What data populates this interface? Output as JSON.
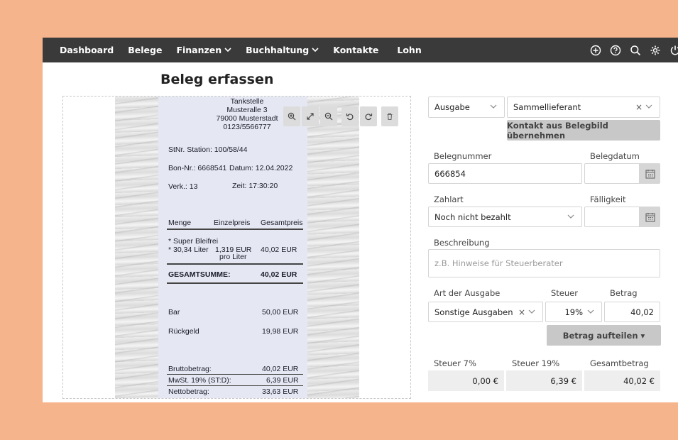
{
  "nav": {
    "items": [
      {
        "label": "Dashboard",
        "dropdown": false
      },
      {
        "label": "Belege",
        "dropdown": false
      },
      {
        "label": "Finanzen",
        "dropdown": true
      },
      {
        "label": "Buchhaltung",
        "dropdown": true
      },
      {
        "label": "Kontakte",
        "dropdown": false
      },
      {
        "label": "Lohn",
        "dropdown": false
      }
    ],
    "icons": [
      "add-circle-icon",
      "help-icon",
      "search-icon",
      "gear-icon",
      "power-icon"
    ]
  },
  "page": {
    "title": "Beleg erfassen"
  },
  "receipt": {
    "station_name": "Tankstelle",
    "street": "Musteralle 3",
    "city": "79000 Musterstadt",
    "phone": "0123/5566777",
    "stnr": "StNr. Station: 100/58/44",
    "bon_nr": "Bon-Nr.: 6668541",
    "datum": "Datum: 12.04.2022",
    "verk": "Verk.: 13",
    "zeit": "Zeit: 17:30:20",
    "col_menge": "Menge",
    "col_einzelpreis": "Einzelpreis",
    "col_gesamtpreis": "Gesamtpreis",
    "item_name": "* Super Bleifrei",
    "item_qty": "* 30,34 Liter",
    "item_unit_price": "1,319 EUR",
    "item_unit": "pro Liter",
    "item_total": "40,02 EUR",
    "gesamt_label": "GESAMTSUMME:",
    "gesamt_value": "40,02 EUR",
    "bar_label": "Bar",
    "bar_value": "50,00 EUR",
    "rueck_label": "Rückgeld",
    "rueck_value": "19,98 EUR",
    "brutto_label": "Bruttobetrag:",
    "brutto_value": "40,02 EUR",
    "mwst_label": "MwSt. 19% (ST:D):",
    "mwst_value": "6,39 EUR",
    "netto_label": "Nettobetrag:",
    "netto_value": "33,63 EUR"
  },
  "image_toolbar": [
    "zoom-in-icon",
    "expand-icon",
    "zoom-out-icon",
    "rotate-left-icon",
    "rotate-right-icon",
    "trash-icon"
  ],
  "form": {
    "type_select": "Ausgabe",
    "contact_select": "Sammellieferant",
    "contact_button": "Kontakt aus Belegbild übernehmen",
    "belegnummer_label": "Belegnummer",
    "belegnummer_value": "666854",
    "belegdatum_label": "Belegdatum",
    "belegdatum_value": "",
    "zahlart_label": "Zahlart",
    "zahlart_value": "Noch nicht bezahlt",
    "faelligkeit_label": "Fälligkeit",
    "faelligkeit_value": "",
    "beschreibung_label": "Beschreibung",
    "beschreibung_placeholder": "z.B. Hinweise für Steuerberater",
    "art_label": "Art der Ausgabe",
    "art_value": "Sonstige Ausgaben",
    "steuer_label": "Steuer",
    "steuer_value": "19%",
    "betrag_label": "Betrag",
    "betrag_value": "40,02",
    "split_button": "Betrag aufteilen ▾",
    "steuer7_label": "Steuer 7%",
    "steuer7_value": "0,00 €",
    "steuer19_label": "Steuer 19%",
    "steuer19_value": "6,39 €",
    "gesamt_label": "Gesamtbetrag",
    "gesamt_value": "40,02 €"
  },
  "colors": {
    "nav_bg": "#3a3a3a",
    "page_bg": "#f6b48c",
    "button_grey": "#c8c8c8"
  }
}
